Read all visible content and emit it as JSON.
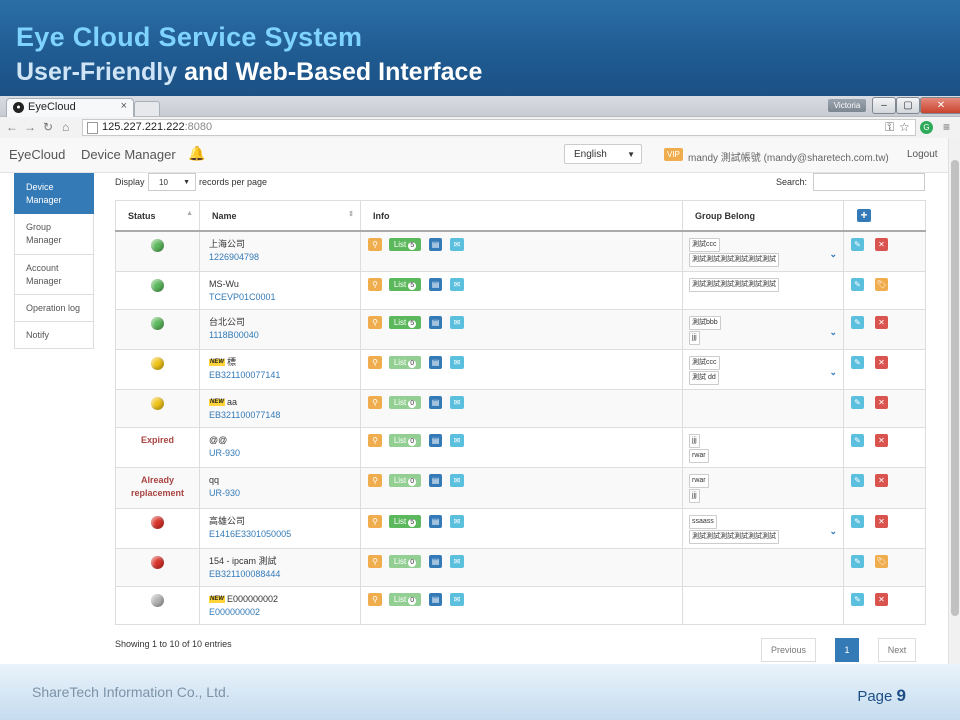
{
  "slide": {
    "title": "Eye Cloud Service System",
    "subtitle_highlight": "User-Friendly",
    "subtitle_rest": " and Web-Based Interface",
    "company": "ShareTech Information Co., Ltd.",
    "page_label": "Page ",
    "page_number": "9"
  },
  "browser": {
    "tab_title": "EyeCloud",
    "tab_close": "×",
    "window_user": "Victoria",
    "url_host": "125.227.221.222",
    "url_port": ":8080"
  },
  "app": {
    "brand": "EyeCloud",
    "nav_device_manager": "Device Manager",
    "language": "English",
    "vip": "VIP",
    "user": "mandy 測試帳號 (mandy@sharetech.com.tw)",
    "logout": "Logout"
  },
  "sidebar": {
    "items": [
      {
        "label": "Device Manager"
      },
      {
        "label": "Group Manager"
      },
      {
        "label": "Account Manager"
      },
      {
        "label": "Operation log"
      },
      {
        "label": "Notify"
      }
    ]
  },
  "toolbar": {
    "display": "Display",
    "page_size": "10",
    "records_per_page": "records per page",
    "search": "Search:"
  },
  "table": {
    "headers": {
      "status": "Status",
      "name": "Name",
      "info": "Info",
      "group": "Group Belong"
    },
    "list_label": "List",
    "rows": [
      {
        "status": "green",
        "new": false,
        "name": "上海公司",
        "id": "1226904798",
        "list_count": "5",
        "list_active": true,
        "groups": [
          "測試ccc",
          "測試測試測試測試測試測試"
        ],
        "chevron": true,
        "second_action": "delete"
      },
      {
        "status": "green",
        "new": false,
        "name": "MS-Wu",
        "id": "TCEVP01C0001",
        "list_count": "5",
        "list_active": true,
        "groups": [
          "測試測試測試測試測試測試"
        ],
        "chevron": false,
        "second_action": "tag"
      },
      {
        "status": "green",
        "new": false,
        "name": "台北公司",
        "id": "1118B00040",
        "list_count": "5",
        "list_active": true,
        "groups": [
          "測試bbb",
          "jjj"
        ],
        "chevron": true,
        "second_action": "delete"
      },
      {
        "status": "yellow",
        "new": true,
        "name": "標",
        "id": "EB321100077141",
        "list_count": "0",
        "list_active": false,
        "groups": [
          "測試ccc",
          "測試 dd"
        ],
        "chevron": true,
        "second_action": "delete"
      },
      {
        "status": "yellow",
        "new": true,
        "name": "aa",
        "id": "EB321100077148",
        "list_count": "0",
        "list_active": false,
        "groups": [],
        "chevron": false,
        "second_action": "delete"
      },
      {
        "status_text": "Expired",
        "new": false,
        "name": "@@",
        "id": "UR-930",
        "list_count": "0",
        "list_active": false,
        "groups": [
          "jjj",
          "rwar"
        ],
        "chevron": false,
        "second_action": "delete"
      },
      {
        "status_text": "Already replacement",
        "new": false,
        "name": "qq",
        "id": "UR-930",
        "list_count": "0",
        "list_active": false,
        "groups": [
          "rwar",
          "jjj"
        ],
        "chevron": false,
        "second_action": "delete"
      },
      {
        "status": "red",
        "new": false,
        "name": "高雄公司",
        "id": "E1416E3301050005",
        "list_count": "5",
        "list_active": true,
        "groups": [
          "ssaass",
          "測試測試測試測試測試測試"
        ],
        "chevron": true,
        "second_action": "delete"
      },
      {
        "status": "red",
        "new": false,
        "name": "154 - ipcam 測試",
        "id": "EB321100088444",
        "list_count": "0",
        "list_active": false,
        "groups": [],
        "chevron": false,
        "second_action": "tag"
      },
      {
        "status": "gray",
        "new": true,
        "name": "E000000002",
        "id": "E000000002",
        "list_count": "0",
        "list_active": false,
        "groups": [],
        "chevron": false,
        "second_action": "delete"
      }
    ]
  },
  "status_colors": {
    "green": "#5cb85c",
    "yellow": "#f0c419",
    "red": "#d9342b",
    "gray": "#b4b4b4"
  },
  "footer": {
    "entries": "Showing 1 to 10 of 10 entries",
    "previous": "Previous",
    "current_page": "1",
    "next": "Next"
  }
}
